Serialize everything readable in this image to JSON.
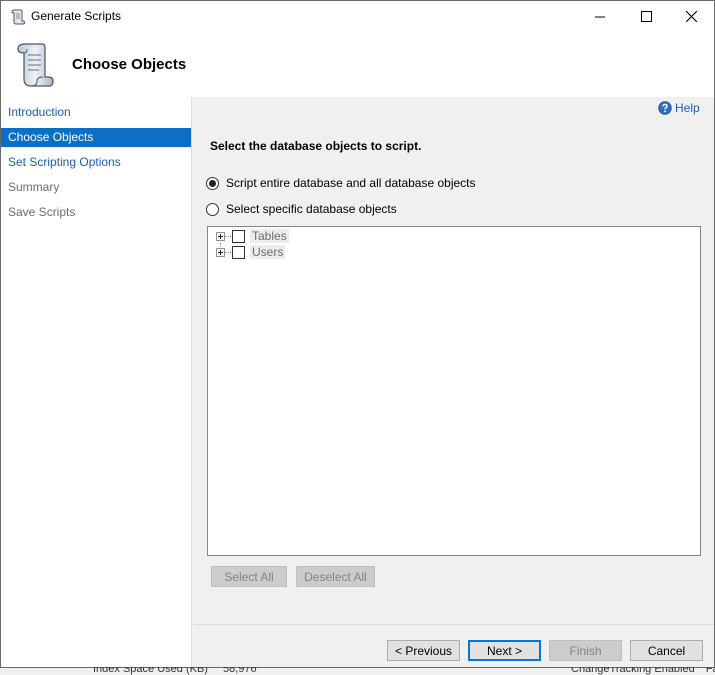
{
  "window": {
    "title": "Generate Scripts",
    "controls": [
      "minimize",
      "maximize",
      "close"
    ]
  },
  "header": {
    "title": "Choose Objects",
    "icon": "scroll-icon"
  },
  "sidebar": {
    "items": [
      {
        "label": "Introduction",
        "state": "link"
      },
      {
        "label": "Choose Objects",
        "state": "active"
      },
      {
        "label": "Set Scripting Options",
        "state": "link"
      },
      {
        "label": "Summary",
        "state": "disabled"
      },
      {
        "label": "Save Scripts",
        "state": "disabled"
      }
    ]
  },
  "main": {
    "help_label": "Help",
    "instruction": "Select the database objects to script.",
    "options": [
      {
        "label": "Script entire database and all database objects",
        "selected": true
      },
      {
        "label": "Select specific database objects",
        "selected": false
      }
    ],
    "tree": [
      {
        "label": "Tables",
        "checked": false
      },
      {
        "label": "Users",
        "checked": false
      }
    ],
    "select_all_label": "Select All",
    "deselect_all_label": "Deselect All"
  },
  "footer": {
    "previous_label": "< Previous",
    "next_label": "Next >",
    "finish_label": "Finish",
    "cancel_label": "Cancel"
  },
  "background_window": {
    "left_label": "Index Space Used (KB)",
    "left_value": "58,976",
    "right_label": "ChangeTracking Enabled",
    "right_value": "False"
  },
  "colors": {
    "accent": "#0b6fc6",
    "link": "#1e5db3",
    "panel": "#f0f0f0"
  }
}
